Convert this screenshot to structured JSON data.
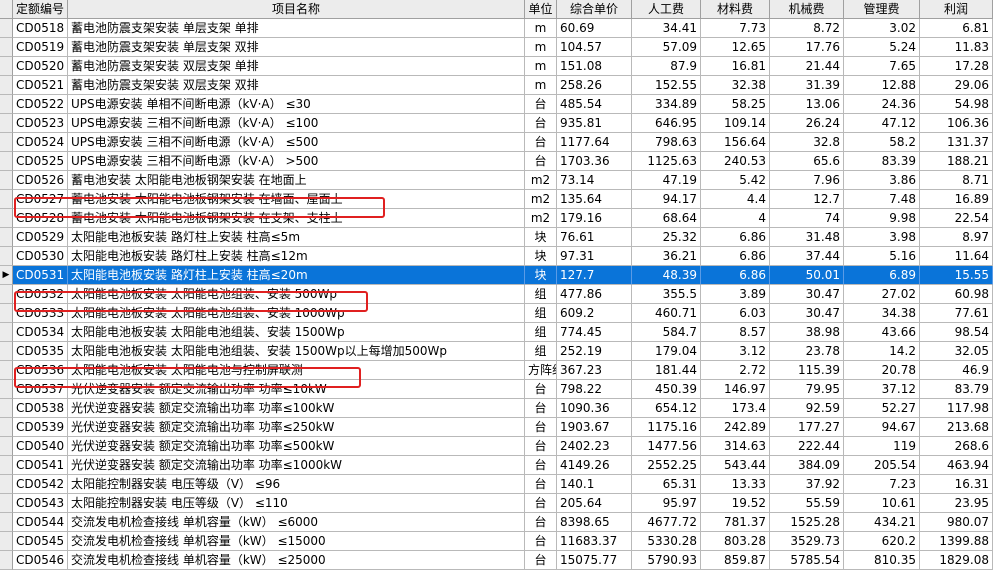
{
  "columns": [
    "定额编号",
    "项目名称",
    "单位",
    "综合单价",
    "人工费",
    "材料费",
    "机械费",
    "管理费",
    "利润"
  ],
  "selected_indicator": "▶",
  "rows": [
    {
      "code": "CD0518",
      "name": "蓄电池防震支架安装 单层支架 单排",
      "unit": "m",
      "price": "60.69",
      "labor": "34.41",
      "material": "7.73",
      "machine": "8.72",
      "manage": "3.02",
      "profit": "6.81"
    },
    {
      "code": "CD0519",
      "name": "蓄电池防震支架安装 单层支架 双排",
      "unit": "m",
      "price": "104.57",
      "labor": "57.09",
      "material": "12.65",
      "machine": "17.76",
      "manage": "5.24",
      "profit": "11.83"
    },
    {
      "code": "CD0520",
      "name": "蓄电池防震支架安装 双层支架 单排",
      "unit": "m",
      "price": "151.08",
      "labor": "87.9",
      "material": "16.81",
      "machine": "21.44",
      "manage": "7.65",
      "profit": "17.28"
    },
    {
      "code": "CD0521",
      "name": "蓄电池防震支架安装 双层支架 双排",
      "unit": "m",
      "price": "258.26",
      "labor": "152.55",
      "material": "32.38",
      "machine": "31.39",
      "manage": "12.88",
      "profit": "29.06"
    },
    {
      "code": "CD0522",
      "name": "UPS电源安装 单相不间断电源（kV·A） ≤30",
      "unit": "台",
      "price": "485.54",
      "labor": "334.89",
      "material": "58.25",
      "machine": "13.06",
      "manage": "24.36",
      "profit": "54.98"
    },
    {
      "code": "CD0523",
      "name": "UPS电源安装 三相不间断电源（kV·A） ≤100",
      "unit": "台",
      "price": "935.81",
      "labor": "646.95",
      "material": "109.14",
      "machine": "26.24",
      "manage": "47.12",
      "profit": "106.36"
    },
    {
      "code": "CD0524",
      "name": "UPS电源安装 三相不间断电源（kV·A） ≤500",
      "unit": "台",
      "price": "1177.64",
      "labor": "798.63",
      "material": "156.64",
      "machine": "32.8",
      "manage": "58.2",
      "profit": "131.37"
    },
    {
      "code": "CD0525",
      "name": "UPS电源安装 三相不间断电源（kV·A） >500",
      "unit": "台",
      "price": "1703.36",
      "labor": "1125.63",
      "material": "240.53",
      "machine": "65.6",
      "manage": "83.39",
      "profit": "188.21"
    },
    {
      "code": "CD0526",
      "name": "蓄电池安装 太阳能电池板钢架安装 在地面上",
      "unit": "m2",
      "price": "73.14",
      "labor": "47.19",
      "material": "5.42",
      "machine": "7.96",
      "manage": "3.86",
      "profit": "8.71"
    },
    {
      "code": "CD0527",
      "name": "蓄电池安装 太阳能电池板钢架安装 在墙面、屋面上",
      "unit": "m2",
      "price": "135.64",
      "labor": "94.17",
      "material": "4.4",
      "machine": "12.7",
      "manage": "7.48",
      "profit": "16.89"
    },
    {
      "code": "CD0528",
      "name": "蓄电池安装 太阳能电池板钢架安装 在支架、支柱上",
      "unit": "m2",
      "price": "179.16",
      "labor": "68.64",
      "material": "4",
      "machine": "74",
      "manage": "9.98",
      "profit": "22.54"
    },
    {
      "code": "CD0529",
      "name": "太阳能电池板安装 路灯柱上安装 柱高≤5m",
      "unit": "块",
      "price": "76.61",
      "labor": "25.32",
      "material": "6.86",
      "machine": "31.48",
      "manage": "3.98",
      "profit": "8.97"
    },
    {
      "code": "CD0530",
      "name": "太阳能电池板安装 路灯柱上安装 柱高≤12m",
      "unit": "块",
      "price": "97.31",
      "labor": "36.21",
      "material": "6.86",
      "machine": "37.44",
      "manage": "5.16",
      "profit": "11.64"
    },
    {
      "code": "CD0531",
      "name": "太阳能电池板安装 路灯柱上安装 柱高≤20m",
      "unit": "块",
      "price": "127.7",
      "labor": "48.39",
      "material": "6.86",
      "machine": "50.01",
      "manage": "6.89",
      "profit": "15.55"
    },
    {
      "code": "CD0532",
      "name": "太阳能电池板安装 太阳能电池组装、安装 500Wp",
      "unit": "组",
      "price": "477.86",
      "labor": "355.5",
      "material": "3.89",
      "machine": "30.47",
      "manage": "27.02",
      "profit": "60.98"
    },
    {
      "code": "CD0533",
      "name": "太阳能电池板安装 太阳能电池组装、安装 1000Wp",
      "unit": "组",
      "price": "609.2",
      "labor": "460.71",
      "material": "6.03",
      "machine": "30.47",
      "manage": "34.38",
      "profit": "77.61"
    },
    {
      "code": "CD0534",
      "name": "太阳能电池板安装 太阳能电池组装、安装 1500Wp",
      "unit": "组",
      "price": "774.45",
      "labor": "584.7",
      "material": "8.57",
      "machine": "38.98",
      "manage": "43.66",
      "profit": "98.54"
    },
    {
      "code": "CD0535",
      "name": "太阳能电池板安装 太阳能电池组装、安装 1500Wp以上每增加500Wp",
      "unit": "组",
      "price": "252.19",
      "labor": "179.04",
      "material": "3.12",
      "machine": "23.78",
      "manage": "14.2",
      "profit": "32.05"
    },
    {
      "code": "CD0536",
      "name": "太阳能电池板安装 太阳能电池与控制屏联测",
      "unit": "方阵组",
      "price": "367.23",
      "labor": "181.44",
      "material": "2.72",
      "machine": "115.39",
      "manage": "20.78",
      "profit": "46.9"
    },
    {
      "code": "CD0537",
      "name": "光伏逆变器安装 额定交流输出功率 功率≤10kW",
      "unit": "台",
      "price": "798.22",
      "labor": "450.39",
      "material": "146.97",
      "machine": "79.95",
      "manage": "37.12",
      "profit": "83.79"
    },
    {
      "code": "CD0538",
      "name": "光伏逆变器安装 额定交流输出功率 功率≤100kW",
      "unit": "台",
      "price": "1090.36",
      "labor": "654.12",
      "material": "173.4",
      "machine": "92.59",
      "manage": "52.27",
      "profit": "117.98"
    },
    {
      "code": "CD0539",
      "name": "光伏逆变器安装 额定交流输出功率 功率≤250kW",
      "unit": "台",
      "price": "1903.67",
      "labor": "1175.16",
      "material": "242.89",
      "machine": "177.27",
      "manage": "94.67",
      "profit": "213.68"
    },
    {
      "code": "CD0540",
      "name": "光伏逆变器安装 额定交流输出功率 功率≤500kW",
      "unit": "台",
      "price": "2402.23",
      "labor": "1477.56",
      "material": "314.63",
      "machine": "222.44",
      "manage": "119",
      "profit": "268.6"
    },
    {
      "code": "CD0541",
      "name": "光伏逆变器安装 额定交流输出功率 功率≤1000kW",
      "unit": "台",
      "price": "4149.26",
      "labor": "2552.25",
      "material": "543.44",
      "machine": "384.09",
      "manage": "205.54",
      "profit": "463.94"
    },
    {
      "code": "CD0542",
      "name": "太阳能控制器安装 电压等级（V） ≤96",
      "unit": "台",
      "price": "140.1",
      "labor": "65.31",
      "material": "13.33",
      "machine": "37.92",
      "manage": "7.23",
      "profit": "16.31"
    },
    {
      "code": "CD0543",
      "name": "太阳能控制器安装 电压等级（V） ≤110",
      "unit": "台",
      "price": "205.64",
      "labor": "95.97",
      "material": "19.52",
      "machine": "55.59",
      "manage": "10.61",
      "profit": "23.95"
    },
    {
      "code": "CD0544",
      "name": "交流发电机检查接线 单机容量（kW） ≤6000",
      "unit": "台",
      "price": "8398.65",
      "labor": "4677.72",
      "material": "781.37",
      "machine": "1525.28",
      "manage": "434.21",
      "profit": "980.07"
    },
    {
      "code": "CD0545",
      "name": "交流发电机检查接线 单机容量（kW） ≤15000",
      "unit": "台",
      "price": "11683.37",
      "labor": "5330.28",
      "material": "803.28",
      "machine": "3529.73",
      "manage": "620.2",
      "profit": "1399.88"
    },
    {
      "code": "CD0546",
      "name": "交流发电机检查接线 单机容量（kW） ≤25000",
      "unit": "台",
      "price": "15075.77",
      "labor": "5790.93",
      "material": "859.87",
      "machine": "5785.54",
      "manage": "810.35",
      "profit": "1829.08"
    }
  ]
}
